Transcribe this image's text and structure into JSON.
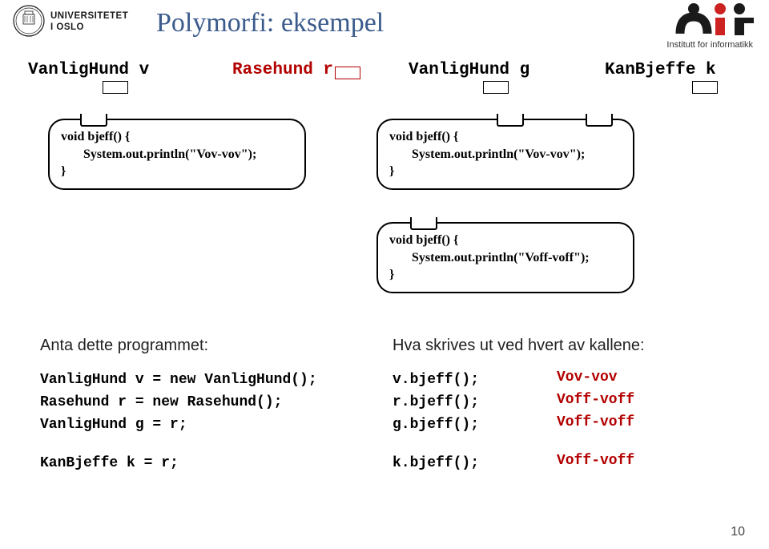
{
  "header": {
    "title": "Polymorfi: eksempel",
    "dept": "Institutt for informatikk",
    "uio_text1": "UNIVERSITETET",
    "uio_text2": "I OSLO"
  },
  "vars": {
    "v": "VanligHund v",
    "r": "Rasehund r",
    "g": "VanligHund g",
    "k": "KanBjeffe k"
  },
  "boxes": {
    "left": {
      "line1": "void bjeff() {",
      "line2": "System.out.println(\"Vov-vov\");",
      "line3": "}"
    },
    "topright": {
      "line1": "void bjeff() {",
      "line2": "System.out.println(\"Vov-vov\");",
      "line3": "}"
    },
    "bottom": {
      "line1": "void bjeff() {",
      "line2": "System.out.println(\"Voff-voff\");",
      "line3": "}"
    }
  },
  "program": {
    "heading": "Anta dette programmet:",
    "l1": "VanligHund v = new VanligHund();",
    "l2": "Rasehund r = new Rasehund();",
    "l3": "VanligHund g = r;",
    "l4": "KanBjeffe k = r;"
  },
  "output": {
    "heading": "Hva skrives ut ved hvert av kallene:",
    "c1": "v.bjeff();",
    "c2": "r.bjeff();",
    "c3": "g.bjeff();",
    "c4": "k.bjeff();",
    "r1": "Vov-vov",
    "r2": "Voff-voff",
    "r3": "Voff-voff",
    "r4": "Voff-voff"
  },
  "page": "10"
}
